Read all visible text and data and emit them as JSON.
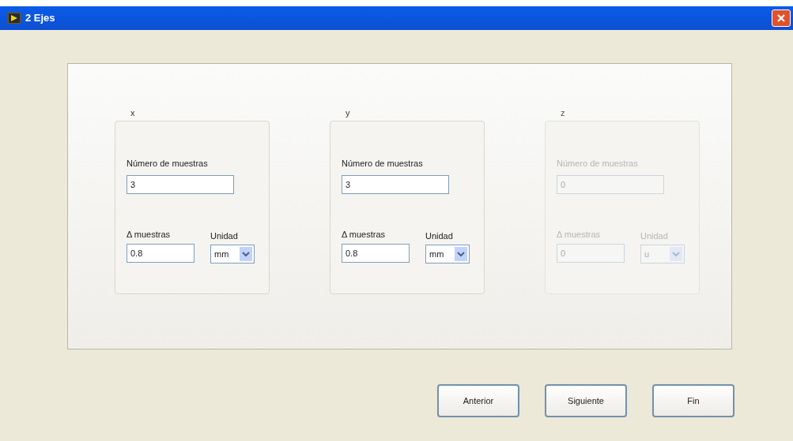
{
  "window": {
    "title": "2 Ejes"
  },
  "axes": [
    {
      "label": "x",
      "disabled": false,
      "samples_label": "Número de muestras",
      "samples_value": "3",
      "delta_label": "Δ muestras",
      "delta_value": "0.8",
      "unit_label": "Unidad",
      "unit_value": "mm"
    },
    {
      "label": "y",
      "disabled": false,
      "samples_label": "Número de muestras",
      "samples_value": "3",
      "delta_label": "Δ muestras",
      "delta_value": "0.8",
      "unit_label": "Unidad",
      "unit_value": "mm"
    },
    {
      "label": "z",
      "disabled": true,
      "samples_label": "Número de muestras",
      "samples_value": "0",
      "delta_label": "Δ muestras",
      "delta_value": "0",
      "unit_label": "Unidad",
      "unit_value": "u"
    }
  ],
  "buttons": [
    "Anterior",
    "Siguiente",
    "Fin"
  ]
}
